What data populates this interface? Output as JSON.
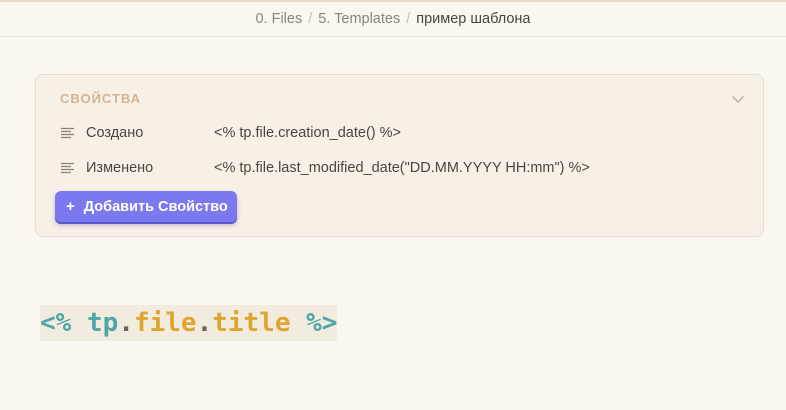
{
  "breadcrumb": {
    "items": [
      "0. Files",
      "5. Templates",
      "пример шаблона"
    ],
    "separator": "/"
  },
  "properties": {
    "title": "СВОЙСТВА",
    "rows": [
      {
        "key": "Создано",
        "value": "<% tp.file.creation_date() %>",
        "icon": "text-lines-icon"
      },
      {
        "key": "Изменено",
        "value": "<% tp.file.last_modified_date(\"DD.MM.YYYY HH:mm\") %>",
        "icon": "text-lines-icon"
      }
    ],
    "add_button": {
      "icon": "+",
      "label": "Добавить Свойство"
    }
  },
  "code": {
    "open": "<%",
    "obj": "tp",
    "dot1": ".",
    "prop1": "file",
    "dot2": ".",
    "prop2": "title",
    "close": "%>"
  },
  "colors": {
    "accent": "#7c79ef",
    "template_teal": "#4ea6a6",
    "template_orange": "#e0a52f",
    "properties_heading": "#d3b494"
  }
}
